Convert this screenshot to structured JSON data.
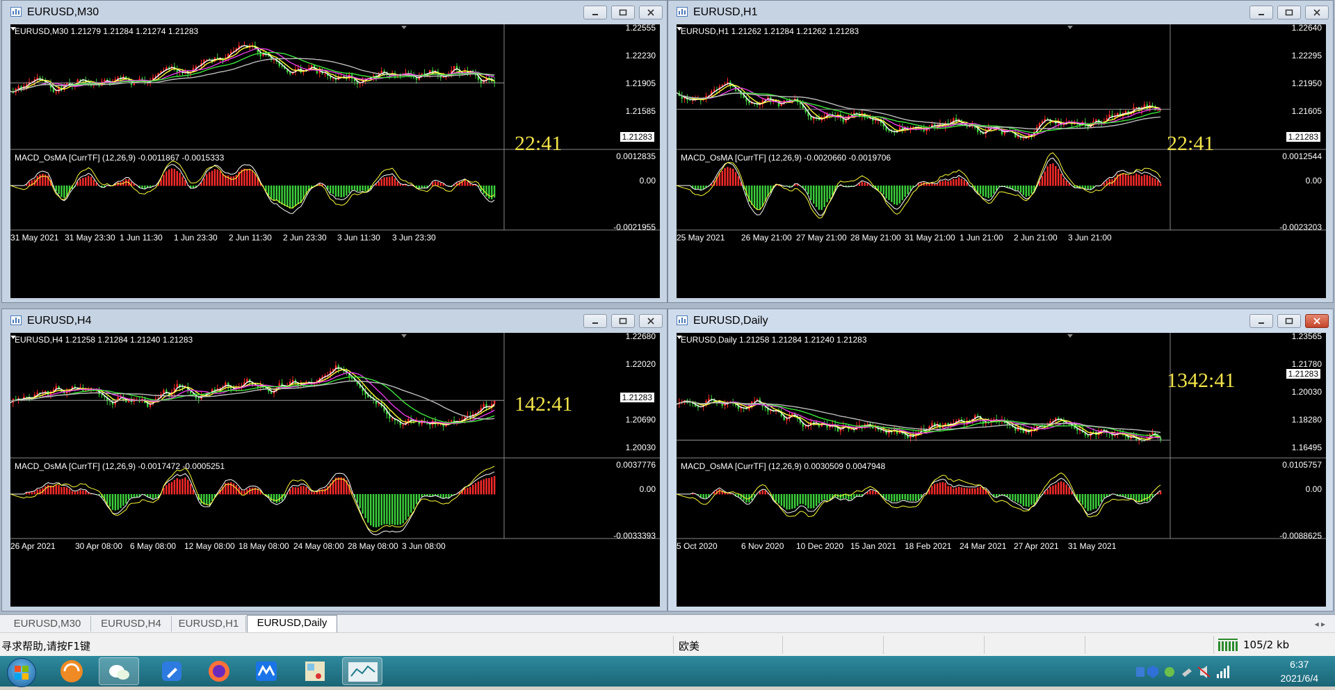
{
  "windows": [
    {
      "title": "EURUSD,M30",
      "info": "EURUSD,M30  1.21279 1.21284 1.21274 1.21283",
      "price_ticks": [
        "1.22555",
        "1.22230",
        "1.21905",
        "1.21585"
      ],
      "current_price": "1.21283",
      "countdown": "22:41",
      "macd_label": "MACD_OsMA [CurrTF] (12,26,9) -0.0011867 -0.0015333",
      "macd_ticks": [
        "0.0012835",
        "0.00",
        "-0.0021955"
      ],
      "dates": [
        "31 May 2021",
        "31 May 23:30",
        "1 Jun 11:30",
        "1 Jun 23:30",
        "2 Jun 11:30",
        "2 Jun 23:30",
        "3 Jun 11:30",
        "3 Jun 23:30"
      ]
    },
    {
      "title": "EURUSD,H1",
      "info": "EURUSD,H1  1.21262 1.21284 1.21262 1.21283",
      "price_ticks": [
        "1.22640",
        "1.22295",
        "1.21950",
        "1.21605"
      ],
      "current_price": "1.21283",
      "countdown": "22:41",
      "macd_label": "MACD_OsMA [CurrTF] (12,26,9) -0.0020660 -0.0019706",
      "macd_ticks": [
        "0.0012544",
        "0.00",
        "-0.0023203"
      ],
      "dates": [
        "25 May 2021",
        "26 May 21:00",
        "27 May 21:00",
        "28 May 21:00",
        "31 May 21:00",
        "1 Jun 21:00",
        "2 Jun 21:00",
        "3 Jun 21:00"
      ]
    },
    {
      "title": "EURUSD,H4",
      "info": "EURUSD,H4  1.21258 1.21284 1.21240 1.21283",
      "price_ticks": [
        "1.22680",
        "1.22020",
        "",
        "1.20690",
        "1.20030"
      ],
      "current_price": "1.21283",
      "countdown": "142:41",
      "macd_label": "MACD_OsMA [CurrTF] (12,26,9) -0.0017472 -0.0005251",
      "macd_ticks": [
        "0.0037776",
        "0.00",
        "-0.0033393"
      ],
      "dates": [
        "26 Apr 2021",
        "30 Apr 08:00",
        "6 May 08:00",
        "12 May 08:00",
        "18 May 08:00",
        "24 May 08:00",
        "28 May 08:00",
        "3 Jun 08:00"
      ]
    },
    {
      "title": "EURUSD,Daily",
      "info": "EURUSD,Daily  1.21258 1.21284 1.21240 1.21283",
      "price_ticks": [
        "1.23565",
        "1.21780",
        "1.20030",
        "1.18280",
        "1.16495"
      ],
      "current_price": "1.21283",
      "countdown": "1342:41",
      "macd_label": "MACD_OsMA [CurrTF] (12,26,9) 0.0030509 0.0047948",
      "macd_ticks": [
        "0.0105757",
        "0.00",
        "-0.0088625"
      ],
      "dates": [
        "5 Oct 2020",
        "6 Nov 2020",
        "10 Dec 2020",
        "15 Jan 2021",
        "18 Feb 2021",
        "24 Mar 2021",
        "27 Apr 2021",
        "31 May 2021"
      ]
    }
  ],
  "tabs": [
    "EURUSD,M30",
    "EURUSD,H4",
    "EURUSD,H1",
    "EURUSD,Daily"
  ],
  "status": {
    "help": "寻求帮助,请按F1键",
    "profile": "欧美",
    "traffic": "105/2 kb"
  },
  "tray": {
    "time": "6:37",
    "date": "2021/6/4"
  },
  "colors": {
    "bull": "#ff2b2b",
    "bear": "#3cd23c",
    "ma_white": "#ffffff",
    "ma_yellow": "#ffff3c",
    "ma_magenta": "#e83ce8",
    "ma_green": "#3ce83c",
    "ma_gray": "#bdbdbd",
    "countdown": "#f0e34a"
  }
}
